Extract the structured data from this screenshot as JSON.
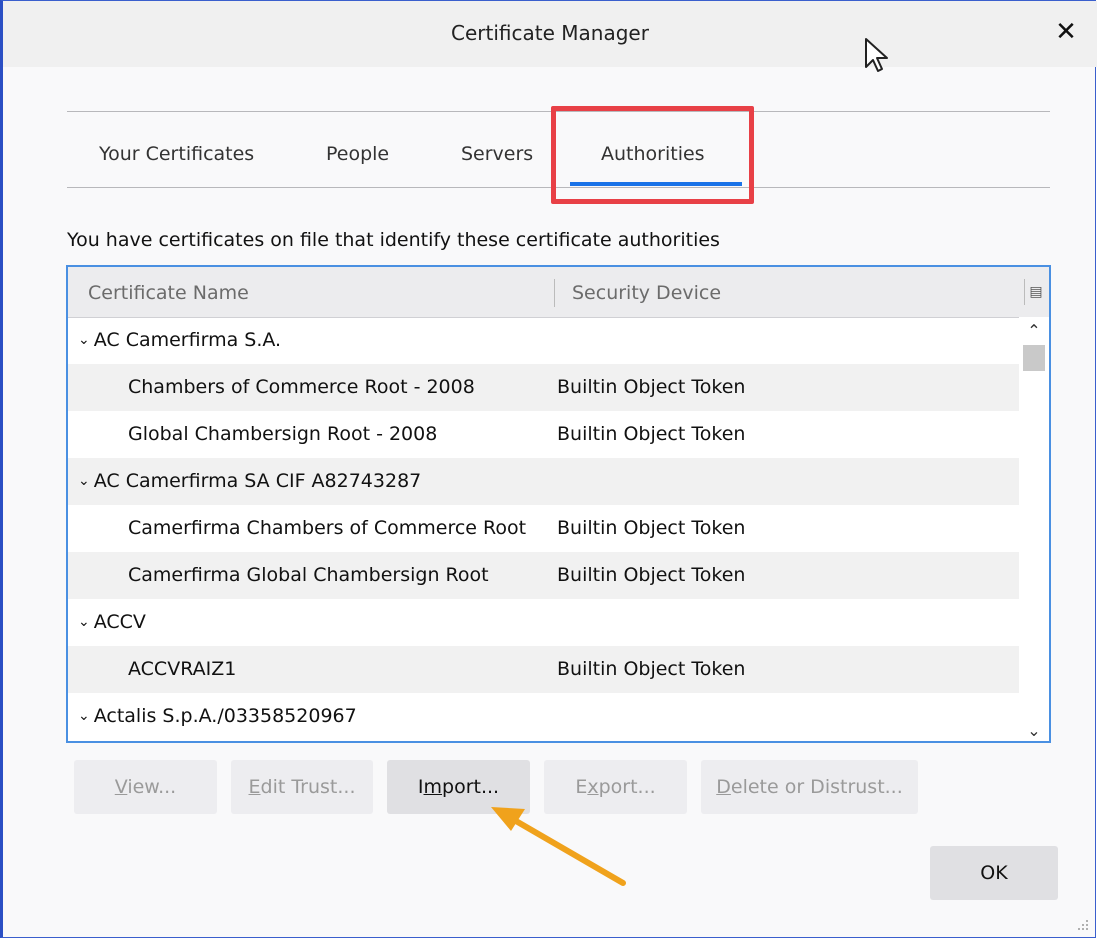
{
  "window": {
    "title": "Certificate Manager",
    "close_label": "✕"
  },
  "tabs": [
    {
      "label": "Your Certificates"
    },
    {
      "label": "People"
    },
    {
      "label": "Servers"
    },
    {
      "label": "Authorities",
      "selected": true
    }
  ],
  "description": "You have certificates on file that identify these certificate authorities",
  "table": {
    "columns": [
      "Certificate Name",
      "Security Device"
    ],
    "rows": [
      {
        "type": "group",
        "name": "AC Camerfirma S.A."
      },
      {
        "type": "item",
        "name": "Chambers of Commerce Root - 2008",
        "device": "Builtin Object Token"
      },
      {
        "type": "item",
        "name": "Global Chambersign Root - 2008",
        "device": "Builtin Object Token"
      },
      {
        "type": "group",
        "name": "AC Camerfirma SA CIF A82743287"
      },
      {
        "type": "item",
        "name": "Camerfirma Chambers of Commerce Root",
        "device": "Builtin Object Token"
      },
      {
        "type": "item",
        "name": "Camerfirma Global Chambersign Root",
        "device": "Builtin Object Token"
      },
      {
        "type": "group",
        "name": "ACCV"
      },
      {
        "type": "item",
        "name": "ACCVRAIZ1",
        "device": "Builtin Object Token"
      },
      {
        "type": "group",
        "name": "Actalis S.p.A./03358520967"
      }
    ]
  },
  "buttons": {
    "view": {
      "pre": "",
      "u": "V",
      "post": "iew..."
    },
    "edit_trust": {
      "pre": "",
      "u": "E",
      "post": "dit Trust..."
    },
    "import": {
      "pre": "I",
      "u": "m",
      "post": "port..."
    },
    "export": {
      "pre": "E",
      "u": "x",
      "post": "port..."
    },
    "delete": {
      "pre": "",
      "u": "D",
      "post": "elete or Distrust..."
    },
    "ok": "OK"
  },
  "colors": {
    "accent": "#1a73e8",
    "highlight_box": "#e84046",
    "annotation_arrow": "#f0a21c"
  }
}
